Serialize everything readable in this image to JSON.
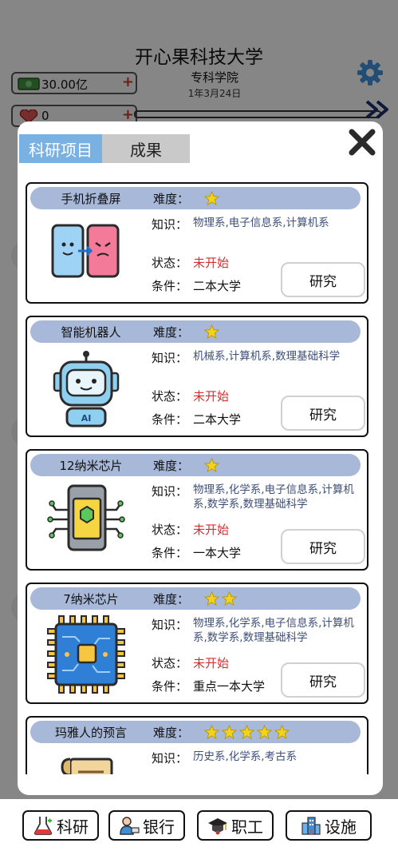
{
  "header": {
    "university": "开心果科技大学",
    "college": "专科学院",
    "date": "1年3月24日",
    "money": "30.00亿",
    "reputation": "0",
    "icons": [
      "money-icon",
      "heart-icon",
      "gear-icon",
      "fast-forward-icon"
    ]
  },
  "modal": {
    "tabs": [
      {
        "label": "科研项目",
        "active": true
      },
      {
        "label": "成果",
        "active": false
      }
    ],
    "close_icon": "close-icon"
  },
  "labels": {
    "difficulty": "难度：",
    "knowledge": "知识：",
    "status": "状态：",
    "condition": "条件：",
    "research": "研究"
  },
  "projects": [
    {
      "name": "手机折叠屏",
      "stars": 1,
      "knowledge": "物理系,电子信息系,计算机系",
      "status": "未开始",
      "condition": "二本大学",
      "icon": "foldable-phone-icon"
    },
    {
      "name": "智能机器人",
      "stars": 1,
      "knowledge": "机械系,计算机系,数理基础科学",
      "status": "未开始",
      "condition": "二本大学",
      "icon": "robot-icon"
    },
    {
      "name": "12纳米芯片",
      "stars": 1,
      "knowledge": "物理系,化学系,电子信息系,计算机系,数学系,数理基础科学",
      "status": "未开始",
      "condition": "一本大学",
      "icon": "chip-12nm-icon"
    },
    {
      "name": "7纳米芯片",
      "stars": 2,
      "knowledge": "物理系,化学系,电子信息系,计算机系,数学系,数理基础科学",
      "status": "未开始",
      "condition": "重点一本大学",
      "icon": "chip-7nm-icon"
    },
    {
      "name": "玛雅人的预言",
      "stars": 5,
      "knowledge": "历史系,化学系,考古系",
      "status": "",
      "condition": "",
      "icon": "scroll-icon"
    }
  ],
  "nav": [
    {
      "label": "科研",
      "icon": "flask-icon"
    },
    {
      "label": "银行",
      "icon": "bank-teller-icon"
    },
    {
      "label": "职工",
      "icon": "graduate-cap-icon"
    },
    {
      "label": "设施",
      "icon": "building-icon"
    }
  ],
  "colors": {
    "tab_active": "#79b1e3",
    "tab_inactive": "#c9c9c9",
    "card_header": "#a8b8d8",
    "status_red": "#e02b2b",
    "knowledge_text": "#3d4f79",
    "star": "#f2d21b"
  }
}
